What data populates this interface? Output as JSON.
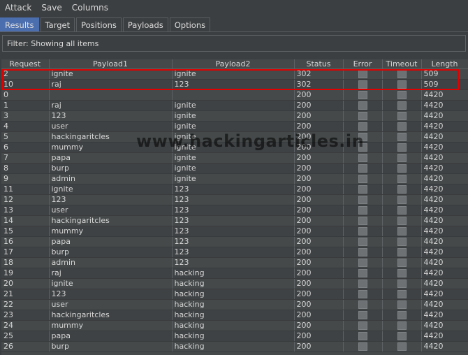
{
  "menu": [
    "Attack",
    "Save",
    "Columns"
  ],
  "tabs": [
    {
      "label": "Results",
      "active": true
    },
    {
      "label": "Target",
      "active": false
    },
    {
      "label": "Positions",
      "active": false
    },
    {
      "label": "Payloads",
      "active": false
    },
    {
      "label": "Options",
      "active": false
    }
  ],
  "filter": {
    "text": "Filter:  Showing all items"
  },
  "table": {
    "columns": [
      "Request",
      "Payload1",
      "Payload2",
      "Status",
      "Error",
      "Timeout",
      "Length"
    ],
    "rows": [
      [
        "2",
        "ignite",
        "ignite",
        "302",
        "",
        "",
        "509"
      ],
      [
        "10",
        "raj",
        "123",
        "302",
        "",
        "",
        "509"
      ],
      [
        "0",
        "",
        "",
        "200",
        "",
        "",
        "4420"
      ],
      [
        "1",
        "raj",
        "ignite",
        "200",
        "",
        "",
        "4420"
      ],
      [
        "3",
        "123",
        "ignite",
        "200",
        "",
        "",
        "4420"
      ],
      [
        "4",
        "user",
        "ignite",
        "200",
        "",
        "",
        "4420"
      ],
      [
        "5",
        "hackingaritcles",
        "ignite",
        "200",
        "",
        "",
        "4420"
      ],
      [
        "6",
        "mummy",
        "ignite",
        "200",
        "",
        "",
        "4420"
      ],
      [
        "7",
        "papa",
        "ignite",
        "200",
        "",
        "",
        "4420"
      ],
      [
        "8",
        "burp",
        "ignite",
        "200",
        "",
        "",
        "4420"
      ],
      [
        "9",
        "admin",
        "ignite",
        "200",
        "",
        "",
        "4420"
      ],
      [
        "11",
        "ignite",
        "123",
        "200",
        "",
        "",
        "4420"
      ],
      [
        "12",
        "123",
        "123",
        "200",
        "",
        "",
        "4420"
      ],
      [
        "13",
        "user",
        "123",
        "200",
        "",
        "",
        "4420"
      ],
      [
        "14",
        "hackingaritcles",
        "123",
        "200",
        "",
        "",
        "4420"
      ],
      [
        "15",
        "mummy",
        "123",
        "200",
        "",
        "",
        "4420"
      ],
      [
        "16",
        "papa",
        "123",
        "200",
        "",
        "",
        "4420"
      ],
      [
        "17",
        "burp",
        "123",
        "200",
        "",
        "",
        "4420"
      ],
      [
        "18",
        "admin",
        "123",
        "200",
        "",
        "",
        "4420"
      ],
      [
        "19",
        "raj",
        "hacking",
        "200",
        "",
        "",
        "4420"
      ],
      [
        "20",
        "ignite",
        "hacking",
        "200",
        "",
        "",
        "4420"
      ],
      [
        "21",
        "123",
        "hacking",
        "200",
        "",
        "",
        "4420"
      ],
      [
        "22",
        "user",
        "hacking",
        "200",
        "",
        "",
        "4420"
      ],
      [
        "23",
        "hackingaritcles",
        "hacking",
        "200",
        "",
        "",
        "4420"
      ],
      [
        "24",
        "mummy",
        "hacking",
        "200",
        "",
        "",
        "4420"
      ],
      [
        "25",
        "papa",
        "hacking",
        "200",
        "",
        "",
        "4420"
      ],
      [
        "26",
        "burp",
        "hacking",
        "200",
        "",
        "",
        "4420"
      ]
    ]
  },
  "watermark": "www.hackingarticles.in",
  "colors": {
    "highlight": "#e00000",
    "active_tab": "#4b6eaf",
    "background": "#3c3f41"
  }
}
